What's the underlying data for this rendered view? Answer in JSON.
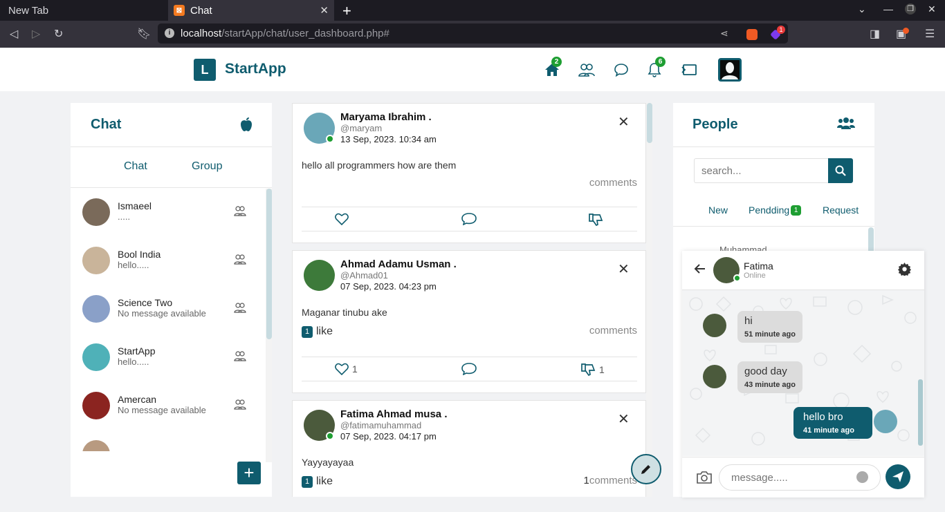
{
  "browser": {
    "tab_inactive": "New Tab",
    "tab_active": "Chat",
    "tab_active_favicon": "XAMPP",
    "url_host": "localhost",
    "url_path": "/startApp/chat/user_dashboard.php#",
    "brave_badge": "1"
  },
  "header": {
    "logo_letter": "L",
    "app_name": "StartApp",
    "home_badge": "2",
    "notif_badge": "6"
  },
  "chat_panel": {
    "title": "Chat",
    "tab_chat": "Chat",
    "tab_group": "Group",
    "items": [
      {
        "name": "Ismaeel",
        "msg": ".....",
        "color": "#7a6a5a"
      },
      {
        "name": "Bool India",
        "msg": "hello.....",
        "color": "#c9b49a"
      },
      {
        "name": "Science Two",
        "msg": "No message available",
        "color": "#8aa0c8"
      },
      {
        "name": "StartApp",
        "msg": "hello.....",
        "color": "#4fb1b8"
      },
      {
        "name": "Amercan",
        "msg": "No message available",
        "color": "#8b2420"
      }
    ]
  },
  "posts": [
    {
      "name": "Maryama Ibrahim .",
      "handle": "@maryam",
      "date": "13 Sep, 2023. 10:34 am",
      "text": "hello all programmers how are them",
      "comments": "comments"
    },
    {
      "name": "Ahmad Adamu Usman .",
      "handle": "@Ahmad01",
      "date": "07 Sep, 2023. 04:23 pm",
      "text": "Maganar tinubu ake",
      "like_badge": "1",
      "like_label": "like",
      "comments": "comments",
      "like_count": "1",
      "dislike_count": "1"
    },
    {
      "name": "Fatima Ahmad musa .",
      "handle": "@fatimamuhammad",
      "date": "07 Sep, 2023. 04:17 pm",
      "text": "Yayyayayaa",
      "like_badge": "1",
      "like_label": "like",
      "comment_count": "1",
      "comments": "comments"
    }
  ],
  "people": {
    "title": "People",
    "search_placeholder": "search...",
    "tab_new": "New",
    "tab_pending": "Pendding",
    "pending_badge": "1",
    "tab_request": "Request",
    "partial_name": "Muhammad"
  },
  "chat_popup": {
    "name": "Fatima",
    "status": "Online",
    "messages": [
      {
        "text": "hi",
        "time": "51 minute ago",
        "dir": "in"
      },
      {
        "text": "good day",
        "time": "43 minute ago",
        "dir": "in"
      },
      {
        "text": "hello bro",
        "time": "41  minute  ago",
        "dir": "out"
      }
    ],
    "input_placeholder": "message....."
  },
  "colors": {
    "brand": "#0f5c6e",
    "badge_green": "#1e9e32"
  }
}
